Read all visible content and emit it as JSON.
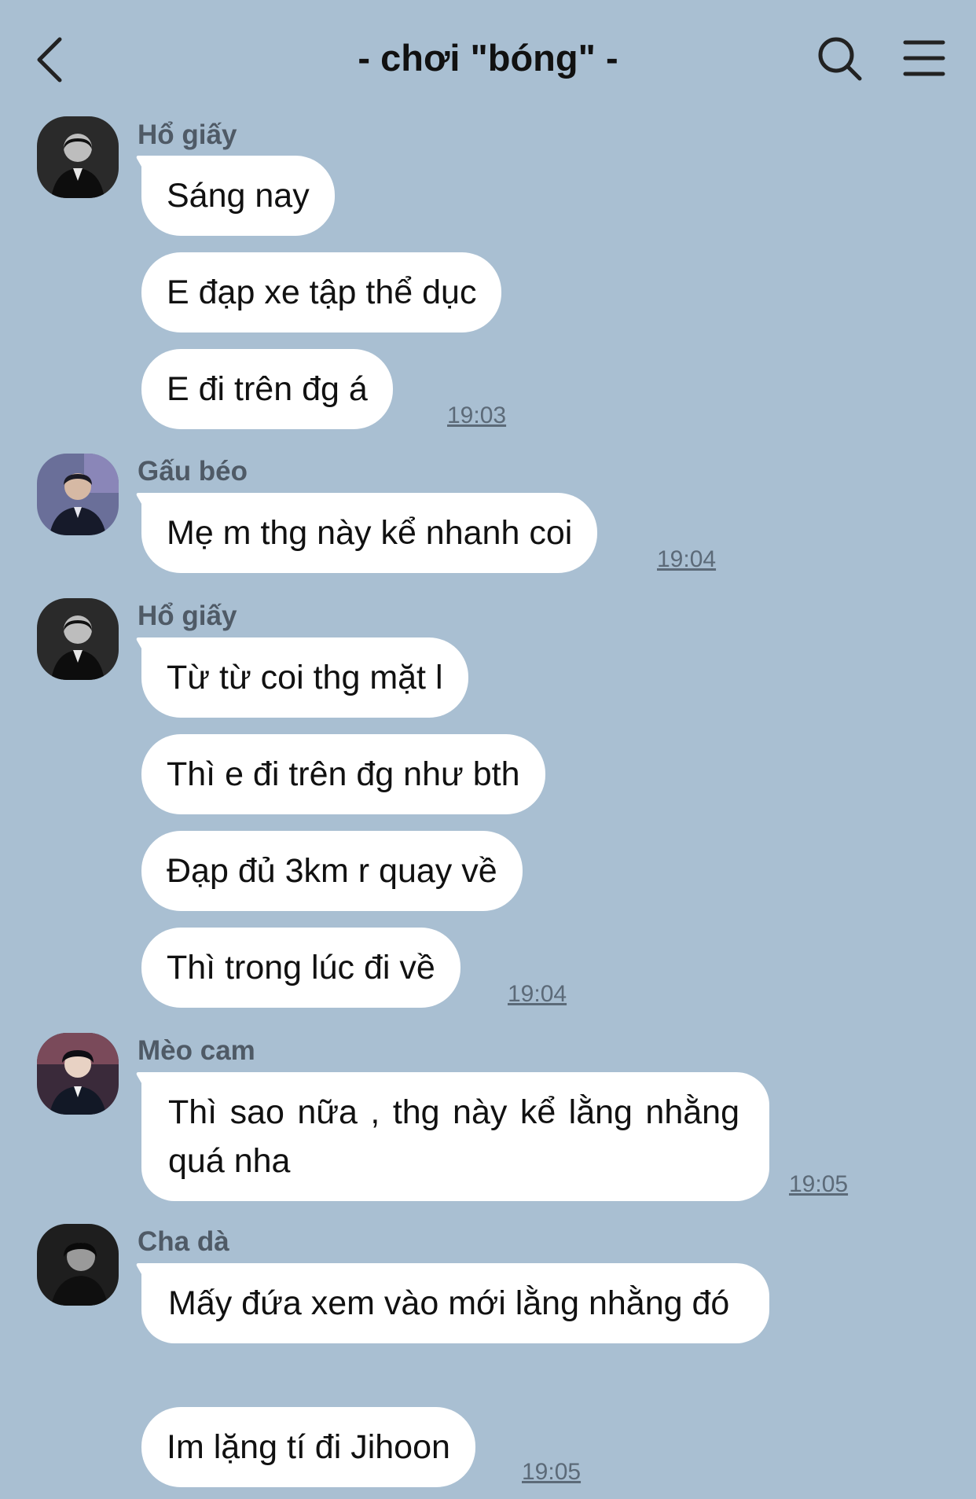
{
  "header": {
    "title": "- chơi \"bóng\" -",
    "back_icon": "chevron-left-icon",
    "search_icon": "search-icon",
    "menu_icon": "menu-icon"
  },
  "colors": {
    "background": "#a9bfd2",
    "bubble": "#ffffff",
    "sender_name": "#4f5a66",
    "timestamp": "#5c6a78"
  },
  "messages": [
    {
      "sender": "Hổ giấy",
      "texts": [
        "Sáng nay",
        "E đạp xe tập thể dục",
        "E đi trên đg á"
      ],
      "time": "19:03"
    },
    {
      "sender": "Gấu béo",
      "texts": [
        "Mẹ m thg này kể nhanh coi"
      ],
      "time": "19:04"
    },
    {
      "sender": "Hổ giấy",
      "texts": [
        "Từ từ coi thg mặt l",
        "Thì e đi trên đg như bth",
        "Đạp đủ 3km r quay về",
        "Thì trong lúc đi về"
      ],
      "time": "19:04"
    },
    {
      "sender": "Mèo cam",
      "texts": [
        "Thì sao nữa , thg này kể lằng nhằng quá nha"
      ],
      "time": "19:05"
    },
    {
      "sender": "Cha dà",
      "texts": [
        "Mấy đứa xem vào mới lằng nhằng đó",
        "Im lặng tí đi Jihoon"
      ],
      "time": "19:05"
    }
  ]
}
